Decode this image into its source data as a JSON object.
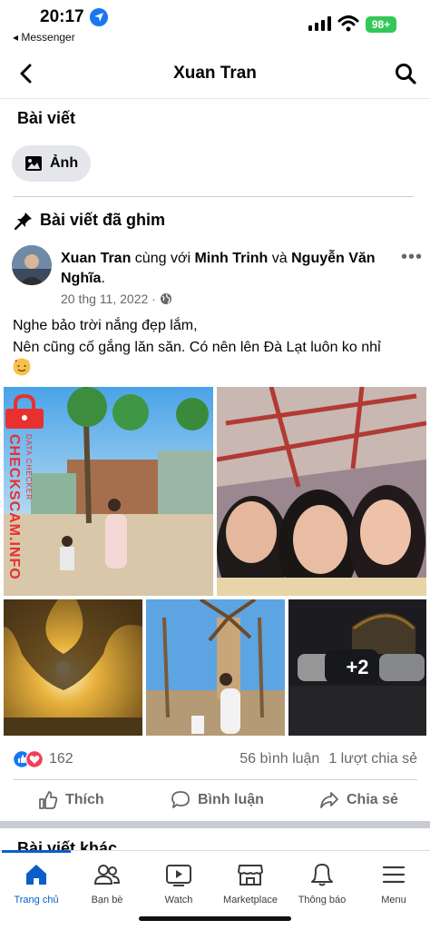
{
  "status_bar": {
    "time": "20:17",
    "back_app": "◂ Messenger",
    "battery": "98+"
  },
  "nav": {
    "title": "Xuan Tran"
  },
  "posts_section": {
    "title": "Bài viết",
    "photo_chip": "Ảnh"
  },
  "pinned": {
    "label": "Bài viết đã ghim"
  },
  "post": {
    "author": "Xuan Tran",
    "with_text": " cùng với ",
    "tag1": "Minh Trinh",
    "and_text": " và ",
    "tag2": "Nguyễn Văn Nghĩa",
    "end": ".",
    "date": "20 thg 11, 2022 ·",
    "line1": "Nghe bảo trời  nắng đẹp lắm,",
    "line2": "Nên cũng cố gắng lăn săn. Có nên lên Đà Lạt luôn ko nhỉ",
    "more_photos": "+2",
    "reaction_count": "162",
    "comments": "56 bình luận",
    "shares": "1 lượt chia sẻ"
  },
  "watermark": {
    "text": "CHECKSCAM.INFO",
    "sub": "DATA CHECKER"
  },
  "actions": {
    "like": "Thích",
    "comment": "Bình luận",
    "share": "Chia sẻ"
  },
  "next_section": {
    "title": "Bài viết khác"
  },
  "tabs": [
    {
      "label": "Trang chủ"
    },
    {
      "label": "Bạn bè"
    },
    {
      "label": "Watch"
    },
    {
      "label": "Marketplace"
    },
    {
      "label": "Thông báo"
    },
    {
      "label": "Menu"
    }
  ],
  "colors": {
    "accent": "#1877f2",
    "active_tab": "#0a5ec9",
    "battery": "#34c759",
    "watermark": "#e8302f"
  }
}
